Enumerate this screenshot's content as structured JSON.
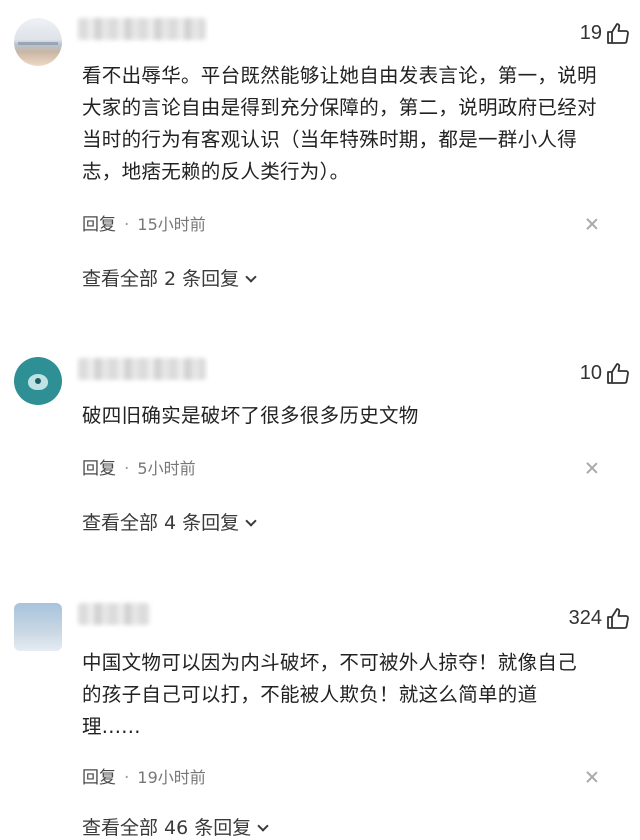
{
  "comments": [
    {
      "likes": "19",
      "text": "看不出辱华。平台既然能够让她自由发表言论，第一，说明大家的言论自由是得到充分保障的，第二，说明政府已经对当时的行为有客观认识（当年特殊时期，都是一群小人得志，地痞无赖的反人类行为）。",
      "reply_label": "回复",
      "separator": "·",
      "time": "15小时前",
      "view_all": "查看全部 2 条回复"
    },
    {
      "likes": "10",
      "text": "破四旧确实是破坏了很多很多历史文物",
      "reply_label": "回复",
      "separator": "·",
      "time": "5小时前",
      "view_all": "查看全部 4 条回复"
    },
    {
      "likes": "324",
      "text": "中国文物可以因为内斗破坏，不可被外人掠夺！就像自己的孩子自己可以打，不能被人欺负！就这么简单的道理......",
      "reply_label": "回复",
      "separator": "·",
      "time": "19小时前",
      "view_all": "查看全部 46 条回复"
    }
  ],
  "icons": {
    "like": "thumb-up-icon",
    "close": "close-icon",
    "expand": "chevron-down-icon"
  }
}
